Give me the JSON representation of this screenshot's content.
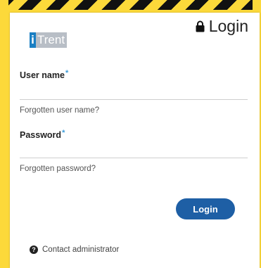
{
  "brand": {
    "logo_i": "i",
    "logo_text": "Trent"
  },
  "header": {
    "title": "Login",
    "lock_icon": "lock-icon"
  },
  "form": {
    "username_label": "User name",
    "password_label": "Password",
    "required_marker": "*",
    "username_value": "",
    "password_value": "",
    "forgot_username": "Forgotten user name?",
    "forgot_password": "Forgotten password?",
    "login_button": "Login"
  },
  "footer": {
    "contact_label": "Contact administrator",
    "help_icon": "help-icon"
  },
  "colors": {
    "accent": "#1e5fa5",
    "brand_blue": "#1a7fc3",
    "required": "#3a9bd9",
    "frame": "#fcd93a"
  }
}
